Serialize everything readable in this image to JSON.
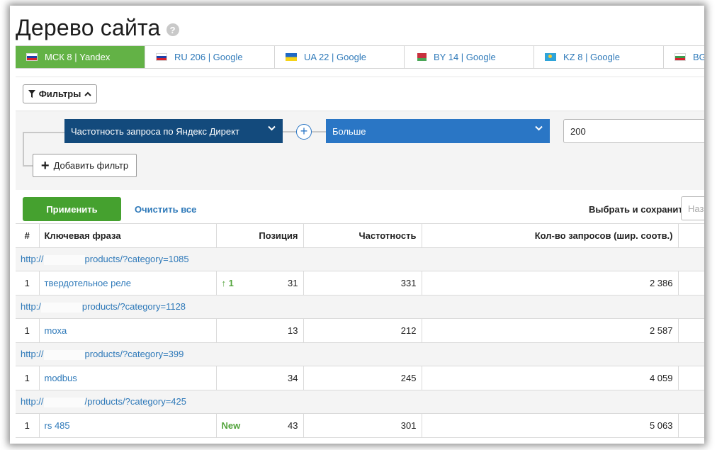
{
  "page": {
    "title": "Дерево сайта",
    "help_icon": "?"
  },
  "tabs": [
    {
      "label": "МСК 8 | Yandex",
      "flag": "ru",
      "active": true
    },
    {
      "label": "RU 206 | Google",
      "flag": "ru",
      "active": false
    },
    {
      "label": "UA 22 | Google",
      "flag": "ua",
      "active": false
    },
    {
      "label": "BY 14 | Google",
      "flag": "by",
      "active": false
    },
    {
      "label": "KZ 8 | Google",
      "flag": "kz",
      "active": false
    },
    {
      "label": "BG",
      "flag": "bg",
      "active": false
    }
  ],
  "filters": {
    "toggle_label": "Фильтры",
    "metric_select": "Частотность запроса по Яндекс Директ",
    "operator_select": "Больше",
    "value": "200",
    "add_filter_label": "Добавить фильтр"
  },
  "actions": {
    "apply_label": "Применить",
    "clear_label": "Очистить все",
    "save_label": "Выбрать и сохранить",
    "name_placeholder": "Наз"
  },
  "table": {
    "headers": {
      "index": "#",
      "keyword": "Ключевая фраза",
      "position": "Позиция",
      "frequency": "Частотность",
      "queries": "Кол-во запросов (шир. соотв.)"
    },
    "groups": [
      {
        "url_prefix": "http://",
        "url_suffix": "products/?category=1085",
        "row": {
          "index": "1",
          "keyword": "твердотельное реле",
          "change": "↑ 1",
          "position": "31",
          "frequency": "331",
          "queries": "2 386"
        }
      },
      {
        "url_prefix": "http:/",
        "url_suffix": "products/?category=1128",
        "row": {
          "index": "1",
          "keyword": "moxa",
          "change": "",
          "position": "13",
          "frequency": "212",
          "queries": "2 587"
        }
      },
      {
        "url_prefix": "http://",
        "url_suffix": "products/?category=399",
        "row": {
          "index": "1",
          "keyword": "modbus",
          "change": "",
          "position": "34",
          "frequency": "245",
          "queries": "4 059"
        }
      },
      {
        "url_prefix": "http://",
        "url_suffix": "/products/?category=425",
        "row": {
          "index": "1",
          "keyword": "rs 485",
          "change": "New",
          "position": "43",
          "frequency": "301",
          "queries": "5 063"
        }
      }
    ]
  },
  "colors": {
    "active_tab": "#63b246",
    "apply_button": "#45a12f",
    "link": "#2e79b9",
    "metric_select": "#134a7c",
    "operator_select": "#2a76c5"
  }
}
